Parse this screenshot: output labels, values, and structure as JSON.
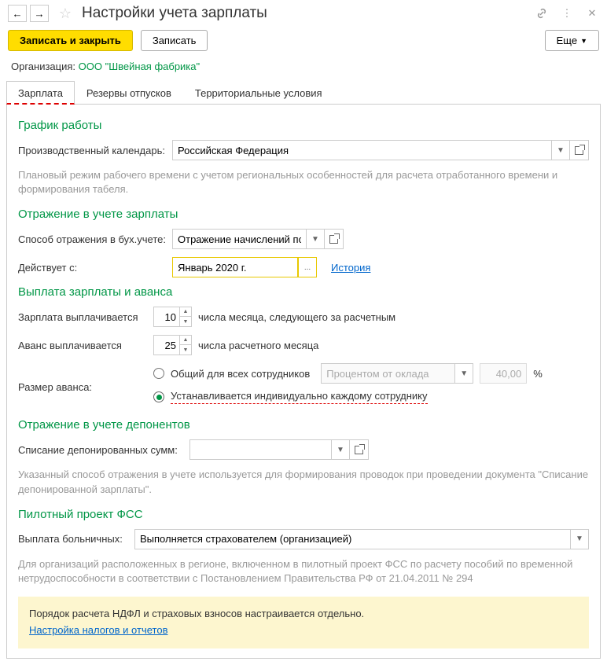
{
  "title": "Настройки учета зарплаты",
  "toolbar": {
    "save_close": "Записать и закрыть",
    "save": "Записать",
    "more": "Еще"
  },
  "org": {
    "label": "Организация:",
    "value": "ООО \"Швейная фабрика\""
  },
  "tabs": [
    "Зарплата",
    "Резервы отпусков",
    "Территориальные условия"
  ],
  "sections": {
    "schedule": {
      "title": "График работы",
      "calendar_label": "Производственный календарь:",
      "calendar_value": "Российская Федерация",
      "hint": "Плановый режим рабочего времени с учетом региональных особенностей для расчета отработанного времени и формирования табеля."
    },
    "reflection": {
      "title": "Отражение в учете зарплаты",
      "method_label": "Способ отражения в бух.учете:",
      "method_value": "Отражение начислений по",
      "effective_label": "Действует с:",
      "effective_value": "Январь 2020 г.",
      "history_link": "История"
    },
    "payment": {
      "title": "Выплата зарплаты и аванса",
      "salary_label": "Зарплата выплачивается",
      "salary_day": "10",
      "salary_suffix": "числа месяца, следующего за расчетным",
      "advance_label": "Аванс выплачивается",
      "advance_day": "25",
      "advance_suffix": "числа расчетного месяца",
      "size_label": "Размер аванса:",
      "r1": "Общий для всех сотрудников",
      "r1_dd": "Процентом от оклада",
      "r1_pct": "40,00",
      "r2": "Устанавливается индивидуально каждому сотруднику"
    },
    "deponent": {
      "title": "Отражение в учете депонентов",
      "writeoff_label": "Списание депонированных сумм:",
      "hint": "Указанный способ отражения в учете используется для формирования проводок при проведении документа \"Списание депонированной зарплаты\"."
    },
    "fss": {
      "title": "Пилотный проект ФСС",
      "sick_label": "Выплата больничных:",
      "sick_value": "Выполняется страхователем (организацией)",
      "hint": "Для организаций расположенных в регионе, включенном в пилотный проект ФСС по расчету пособий по временной нетрудоспособности в соответствии с Постановлением Правительства РФ от 21.04.2011 № 294"
    },
    "yellow": {
      "text": "Порядок расчета НДФЛ и страховых взносов настраивается отдельно.",
      "link": "Настройка налогов и отчетов"
    }
  }
}
